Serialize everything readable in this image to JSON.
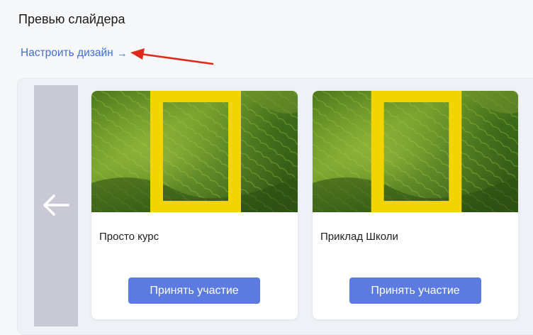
{
  "page": {
    "title": "Превью слайдера"
  },
  "design_link": {
    "label": "Настроить дизайн",
    "arrow": "→"
  },
  "annotation": {
    "color": "#e0281b"
  },
  "slider": {
    "prev_icon": "arrow-left-icon",
    "cards": [
      {
        "title": "Просто курс",
        "cta": "Принять участие",
        "image": "terraced-fields-yellow-frame"
      },
      {
        "title": "Приклад Школи",
        "cta": "Принять участие",
        "image": "terraced-fields-yellow-frame"
      }
    ]
  },
  "colors": {
    "accent": "#5c7be0",
    "link": "#3d6fd6",
    "frame": "#f2d400"
  }
}
